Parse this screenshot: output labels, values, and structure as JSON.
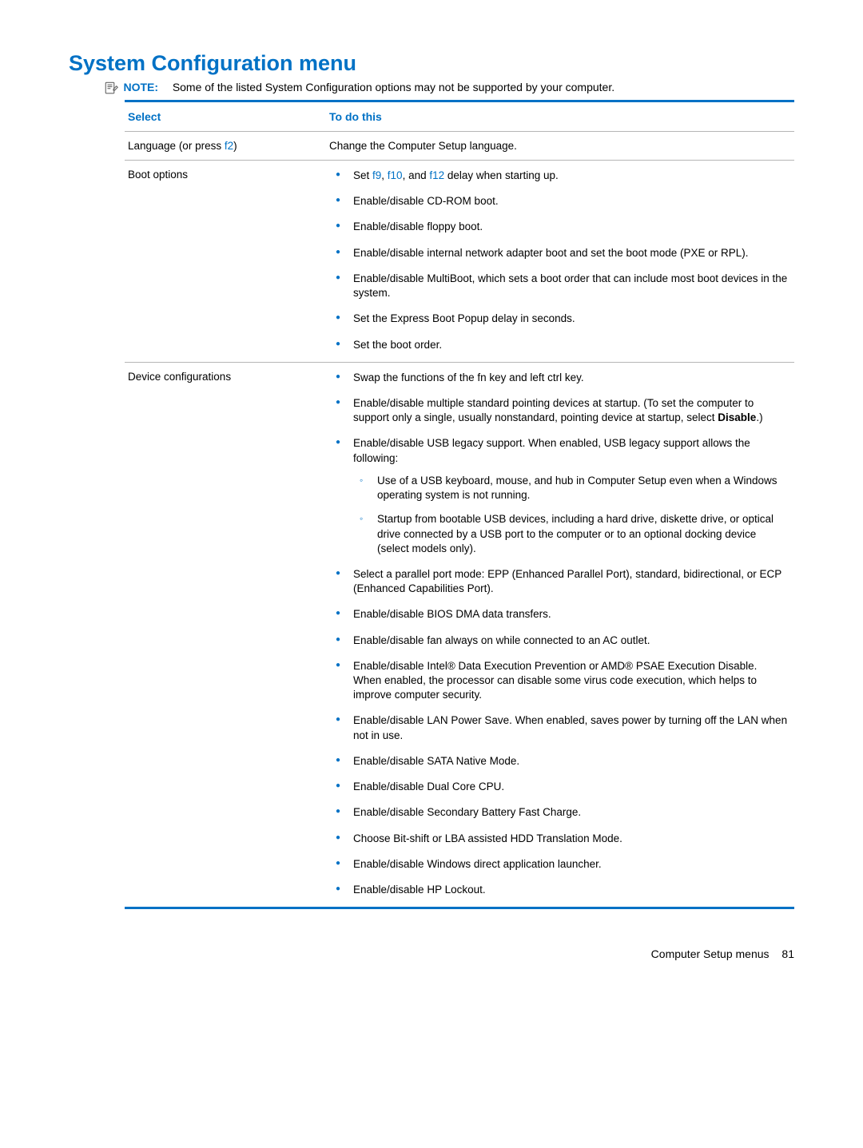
{
  "heading": "System Configuration menu",
  "note": {
    "label": "NOTE:",
    "text": "Some of the listed System Configuration options may not be supported by your computer."
  },
  "table": {
    "header_left": "Select",
    "header_right": "To do this",
    "rows": [
      {
        "left_prefix": "Language (or press ",
        "left_hot": "f2",
        "left_suffix": ")",
        "right_plain": "Change the Computer Setup language."
      },
      {
        "left": "Boot options",
        "items": [
          {
            "pre": "Set ",
            "hot1": "f9",
            "mid1": ", ",
            "hot2": "f10",
            "mid2": ", and ",
            "hot3": "f12",
            "post": " delay when starting up."
          },
          {
            "text": "Enable/disable CD-ROM boot."
          },
          {
            "text": "Enable/disable floppy boot."
          },
          {
            "text": "Enable/disable internal network adapter boot and set the boot mode (PXE or RPL)."
          },
          {
            "text": "Enable/disable MultiBoot, which sets a boot order that can include most boot devices in the system."
          },
          {
            "text": "Set the Express Boot Popup delay in seconds."
          },
          {
            "text": "Set the boot order."
          }
        ]
      },
      {
        "left": "Device configurations",
        "items": [
          {
            "text": "Swap the functions of the fn key and left ctrl key."
          },
          {
            "pre": "Enable/disable multiple standard pointing devices at startup. (To set the computer to support only a single, usually nonstandard, pointing device at startup, select ",
            "bold": "Disable",
            "post": ".)"
          },
          {
            "text": "Enable/disable USB legacy support. When enabled, USB legacy support allows the following:",
            "sub": [
              "Use of a USB keyboard, mouse, and hub in Computer Setup even when a Windows operating system is not running.",
              "Startup from bootable USB devices, including a hard drive, diskette drive, or optical drive connected by a USB port to the computer or to an optional docking device (select models only)."
            ]
          },
          {
            "text": "Select a parallel port mode: EPP (Enhanced Parallel Port), standard, bidirectional, or ECP (Enhanced Capabilities Port)."
          },
          {
            "text": "Enable/disable BIOS DMA data transfers."
          },
          {
            "text": "Enable/disable fan always on while connected to an AC outlet."
          },
          {
            "text": "Enable/disable Intel® Data Execution Prevention or AMD® PSAE Execution Disable. When enabled, the processor can disable some virus code execution, which helps to improve computer security."
          },
          {
            "text": "Enable/disable LAN Power Save. When enabled, saves power by turning off the LAN when not in use."
          },
          {
            "text": "Enable/disable SATA Native Mode."
          },
          {
            "text": "Enable/disable Dual Core CPU."
          },
          {
            "text": "Enable/disable Secondary Battery Fast Charge."
          },
          {
            "text": "Choose Bit-shift or LBA assisted HDD Translation Mode."
          },
          {
            "text": "Enable/disable Windows direct application launcher."
          },
          {
            "text": "Enable/disable HP Lockout."
          }
        ]
      }
    ]
  },
  "footer": {
    "section": "Computer Setup menus",
    "page": "81"
  }
}
